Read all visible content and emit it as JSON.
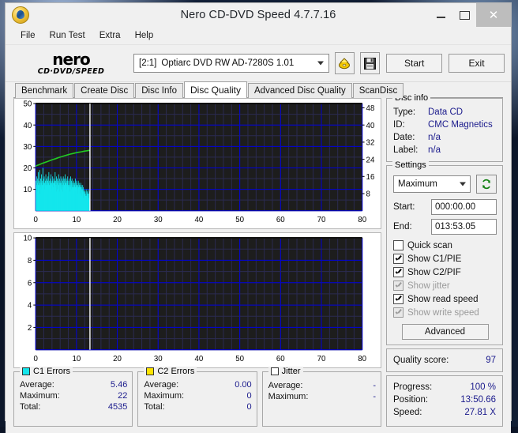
{
  "window": {
    "title": "Nero CD-DVD Speed 4.7.7.16",
    "app_icon": "disc-icon",
    "minimize": "–",
    "maximize": "□",
    "close": "✕"
  },
  "menu": [
    {
      "label": "File"
    },
    {
      "label": "Run Test"
    },
    {
      "label": "Extra"
    },
    {
      "label": "Help"
    }
  ],
  "toolbar": {
    "logo_line1": "nero",
    "logo_line2": "CD·DVD∕SPEED",
    "drive_number": "[2:1]",
    "drive_name": "Optiarc DVD RW AD-7280S 1.01",
    "eject_icon": "disc-eject-icon",
    "save_icon": "floppy-save-icon",
    "start_label": "Start",
    "exit_label": "Exit"
  },
  "tabs": [
    {
      "label": "Benchmark",
      "active": false
    },
    {
      "label": "Create Disc",
      "active": false
    },
    {
      "label": "Disc Info",
      "active": false
    },
    {
      "label": "Disc Quality",
      "active": true
    },
    {
      "label": "Advanced Disc Quality",
      "active": false
    },
    {
      "label": "ScanDisc",
      "active": false
    }
  ],
  "disc_info": {
    "legend": "Disc info",
    "rows": [
      {
        "key": "Type:",
        "value": "Data CD"
      },
      {
        "key": "ID:",
        "value": "CMC Magnetics"
      },
      {
        "key": "Date:",
        "value": "n/a"
      },
      {
        "key": "Label:",
        "value": "n/a"
      }
    ]
  },
  "settings": {
    "legend": "Settings",
    "speed_value": "Maximum",
    "refresh_icon": "refresh-icon",
    "start_label": "Start:",
    "start_value": "000:00.00",
    "end_label": "End:",
    "end_value": "013:53.05",
    "checkboxes": [
      {
        "label": "Quick scan",
        "checked": false,
        "disabled": false
      },
      {
        "label": "Show C1/PIE",
        "checked": true,
        "disabled": false
      },
      {
        "label": "Show C2/PIF",
        "checked": true,
        "disabled": false
      },
      {
        "label": "Show jitter",
        "checked": true,
        "disabled": true
      },
      {
        "label": "Show read speed",
        "checked": true,
        "disabled": false
      },
      {
        "label": "Show write speed",
        "checked": true,
        "disabled": true
      }
    ],
    "advanced_label": "Advanced"
  },
  "quality": {
    "label": "Quality score:",
    "value": "97"
  },
  "progress": {
    "rows": [
      {
        "key": "Progress:",
        "value": "100 %"
      },
      {
        "key": "Position:",
        "value": "13:50.66"
      },
      {
        "key": "Speed:",
        "value": "27.81 X"
      }
    ]
  },
  "c1_errors": {
    "legend": "C1 Errors",
    "color": "#14e6ec",
    "rows": [
      {
        "key": "Average:",
        "value": "5.46"
      },
      {
        "key": "Maximum:",
        "value": "22"
      },
      {
        "key": "Total:",
        "value": "4535"
      }
    ]
  },
  "c2_errors": {
    "legend": "C2 Errors",
    "color": "#ffe400",
    "rows": [
      {
        "key": "Average:",
        "value": "0.00"
      },
      {
        "key": "Maximum:",
        "value": "0"
      },
      {
        "key": "Total:",
        "value": "0"
      }
    ]
  },
  "jitter": {
    "legend": "Jitter",
    "color": "#ffffff",
    "rows": [
      {
        "key": "Average:",
        "value": "-"
      },
      {
        "key": "Maximum:",
        "value": "-"
      }
    ]
  },
  "chart_data": [
    {
      "id": "c1-chart",
      "type": "bar",
      "title": "",
      "xlabel": "",
      "ylabel": "C1 errors",
      "xlim": [
        0,
        80
      ],
      "ylim": [
        0,
        50
      ],
      "y2lim": [
        0,
        50
      ],
      "xticks": [
        0,
        10,
        20,
        30,
        40,
        50,
        60,
        70,
        80
      ],
      "yticks": [
        10,
        20,
        30,
        40,
        50
      ],
      "y2ticks": [
        8,
        16,
        24,
        32,
        40,
        48
      ],
      "grid": true,
      "plot_bg": "#1d1d1d",
      "grid_color": "#0000d8",
      "marker_x": 13.3,
      "marker_color": "#ffffff",
      "series": [
        {
          "name": "C1 Errors",
          "type": "bar",
          "color": "#14e6ec",
          "x_end": 13.3,
          "values": [
            14,
            12,
            11,
            16,
            13,
            9,
            15,
            11,
            18,
            12,
            10,
            14,
            12,
            19,
            13,
            8,
            12,
            15,
            11,
            13,
            17,
            10,
            14,
            12,
            9,
            20,
            13,
            11,
            15,
            12,
            16,
            10,
            13,
            9,
            14,
            12,
            17,
            11,
            13,
            15,
            10,
            12,
            14,
            8,
            16,
            13,
            11,
            18,
            12,
            10,
            14,
            13,
            9,
            15,
            12,
            17,
            11,
            13,
            10,
            14,
            12,
            16,
            9,
            13,
            11,
            15,
            12,
            14,
            10,
            13,
            18,
            11,
            14,
            12,
            9,
            16,
            13,
            10,
            15,
            12,
            14,
            11,
            13,
            17,
            10,
            12,
            15,
            9,
            13,
            11,
            14,
            16,
            12,
            10,
            13,
            15,
            11,
            14,
            12,
            9,
            16,
            13,
            11,
            15,
            10,
            12,
            14,
            17,
            9,
            13,
            11,
            15,
            12,
            10,
            14,
            13,
            16,
            9,
            12,
            11,
            14,
            10,
            13,
            15,
            12,
            9,
            11,
            16,
            13,
            10,
            14,
            12,
            15,
            11,
            9,
            13,
            10,
            12,
            14,
            11,
            8,
            13,
            12,
            10,
            15,
            11,
            9,
            12,
            14,
            10,
            13,
            11,
            8,
            12,
            10,
            14,
            9,
            11,
            13,
            10,
            12,
            8,
            11,
            9,
            13,
            10,
            12,
            11,
            7,
            10,
            9,
            12,
            8,
            11,
            6,
            9,
            7,
            10,
            8,
            5,
            9,
            7,
            6,
            8,
            10,
            7,
            5,
            9,
            6,
            8,
            7,
            10,
            6,
            5,
            8,
            7,
            9,
            6,
            4
          ]
        },
        {
          "name": "Read speed",
          "type": "line",
          "color": "#22cc22",
          "axis": "right",
          "x_end": 13.3,
          "points": [
            [
              0,
              20.8
            ],
            [
              0.4,
              21.2
            ],
            [
              1.0,
              21.6
            ],
            [
              1.6,
              22.1
            ],
            [
              2.2,
              22.5
            ],
            [
              2.8,
              22.9
            ],
            [
              3.5,
              23.4
            ],
            [
              4.2,
              23.9
            ],
            [
              4.9,
              24.3
            ],
            [
              5.6,
              24.8
            ],
            [
              6.3,
              25.2
            ],
            [
              7.0,
              25.6
            ],
            [
              7.7,
              26.0
            ],
            [
              8.4,
              26.4
            ],
            [
              9.1,
              26.7
            ],
            [
              9.8,
              27.0
            ],
            [
              10.5,
              27.3
            ],
            [
              11.2,
              27.5
            ],
            [
              11.9,
              27.8
            ],
            [
              12.6,
              28.0
            ],
            [
              13.3,
              28.2
            ]
          ]
        }
      ]
    },
    {
      "id": "c2-chart",
      "type": "bar",
      "title": "",
      "xlabel": "",
      "ylabel": "C2 errors",
      "xlim": [
        0,
        80
      ],
      "ylim": [
        0,
        10
      ],
      "xticks": [
        0,
        10,
        20,
        30,
        40,
        50,
        60,
        70,
        80
      ],
      "yticks": [
        2,
        4,
        6,
        8,
        10
      ],
      "grid": true,
      "plot_bg": "#1d1d1d",
      "grid_color": "#0000d8",
      "marker_x": 13.3,
      "marker_color": "#ffffff",
      "series": [
        {
          "name": "C2 Errors",
          "type": "bar",
          "color": "#ffe400",
          "values": []
        }
      ]
    }
  ]
}
